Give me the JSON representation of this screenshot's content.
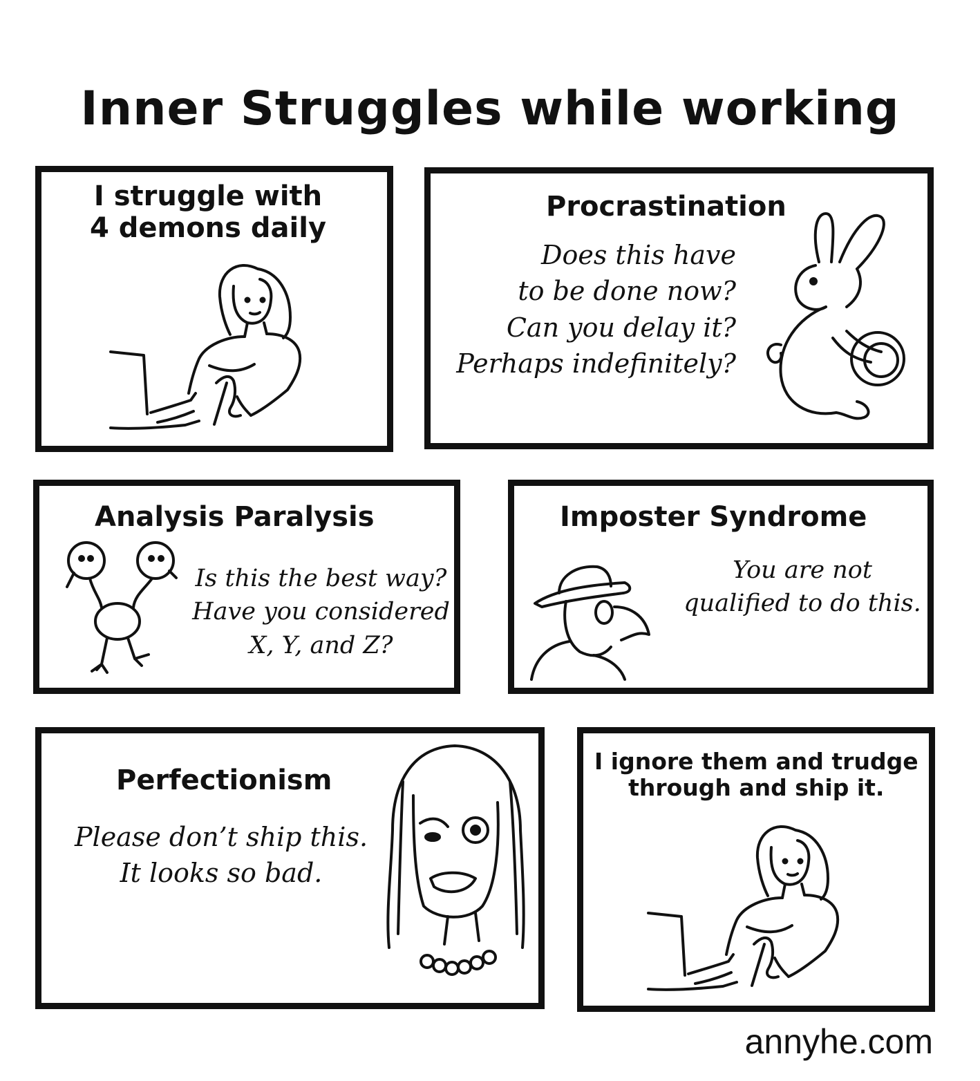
{
  "title": "Inner Struggles while working",
  "panels": {
    "intro": {
      "heading": [
        "I struggle with",
        "4 demons daily"
      ],
      "icon": "woman-at-laptop"
    },
    "procrastination": {
      "heading": "Procrastination",
      "quote": [
        "Does this have",
        "to be done now?",
        "Can you delay it?",
        "Perhaps indefinitely?"
      ],
      "icon": "rabbit-with-wheel"
    },
    "analysis_paralysis": {
      "heading": "Analysis Paralysis",
      "quote": [
        "Is this the best way?",
        "Have you considered",
        "X, Y, and Z?"
      ],
      "icon": "two-headed-bird"
    },
    "imposter_syndrome": {
      "heading": "Imposter Syndrome",
      "quote": [
        "You are not",
        "qualified to do this."
      ],
      "icon": "bird-in-hat"
    },
    "perfectionism": {
      "heading": "Perfectionism",
      "quote": [
        "Please don’t ship this.",
        "It looks so bad."
      ],
      "icon": "scowling-woman"
    },
    "resolution": {
      "heading": [
        "I ignore them and trudge",
        "through and ship it."
      ],
      "icon": "woman-at-laptop"
    }
  },
  "footer": "annyhe.com"
}
